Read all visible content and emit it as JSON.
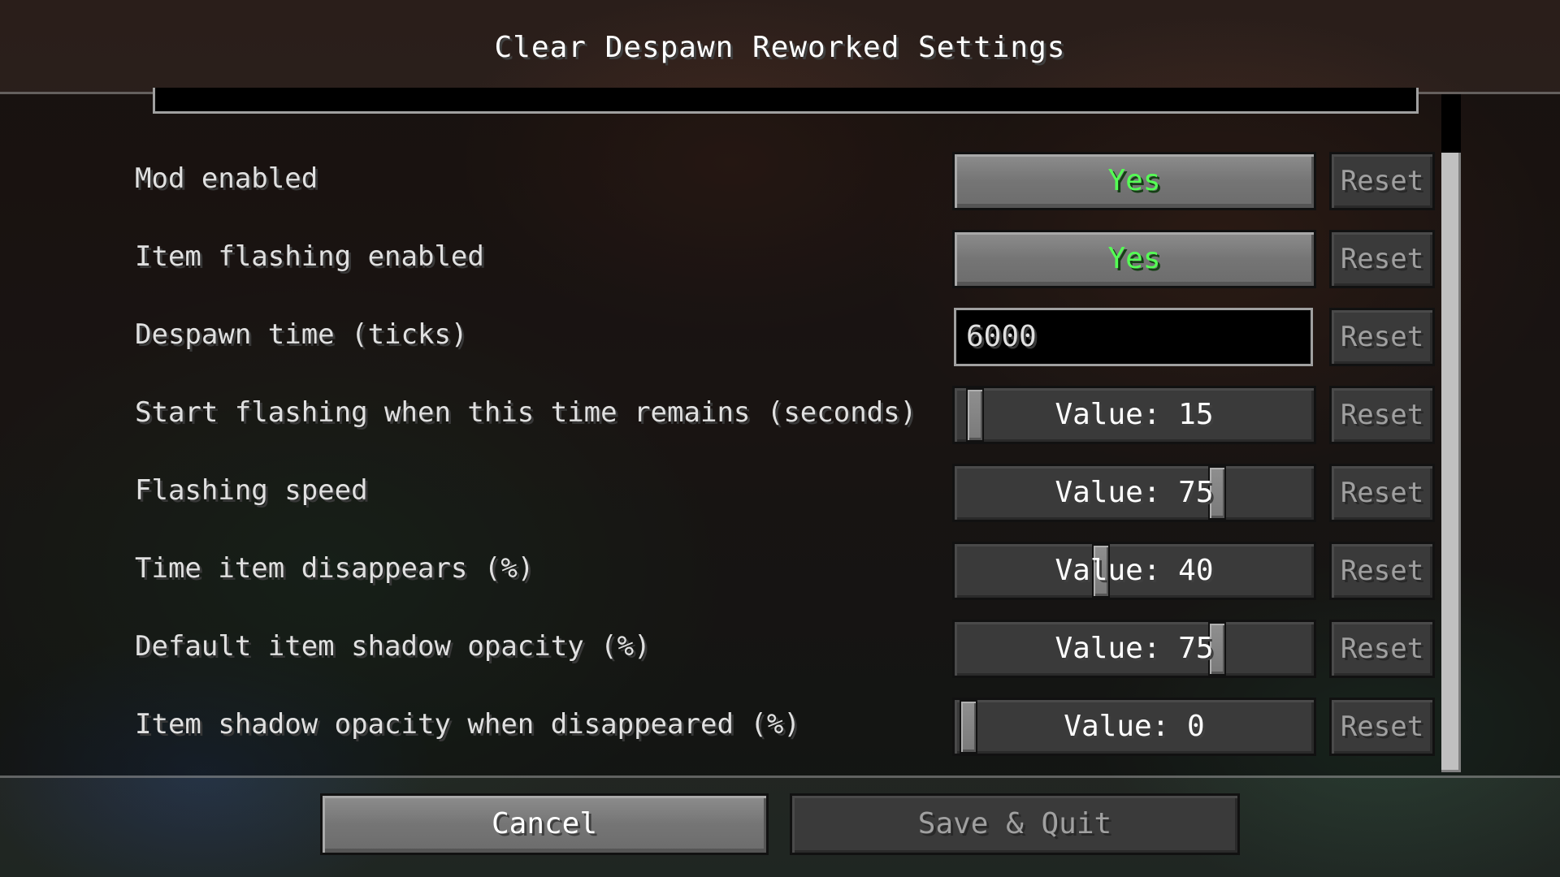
{
  "window": {
    "title": "Clear Despawn Reworked Settings"
  },
  "settings": [
    {
      "label": "Mod enabled",
      "control": "toggle",
      "value": "Yes",
      "reset_label": "Reset"
    },
    {
      "label": "Item flashing enabled",
      "control": "toggle",
      "value": "Yes",
      "reset_label": "Reset"
    },
    {
      "label": "Despawn time (ticks)",
      "control": "text",
      "value": "6000",
      "reset_label": "Reset"
    },
    {
      "label": "Start flashing when this time remains (seconds)",
      "control": "slider",
      "value_text": "Value: 15",
      "level": 0.02,
      "reset_label": "Reset"
    },
    {
      "label": "Flashing speed",
      "control": "slider",
      "value_text": "Value: 75",
      "level": 0.75,
      "reset_label": "Reset"
    },
    {
      "label": "Time item disappears (%)",
      "control": "slider",
      "value_text": "Value: 40",
      "level": 0.4,
      "reset_label": "Reset"
    },
    {
      "label": "Default item shadow opacity (%)",
      "control": "slider",
      "value_text": "Value: 75",
      "level": 0.75,
      "reset_label": "Reset"
    },
    {
      "label": "Item shadow opacity when disappeared (%)",
      "control": "slider",
      "value_text": "Value: 0",
      "level": 0.0,
      "reset_label": "Reset"
    }
  ],
  "footer": {
    "cancel_label": "Cancel",
    "save_label": "Save & Quit"
  },
  "colors": {
    "toggle_on": "#55ff55"
  }
}
